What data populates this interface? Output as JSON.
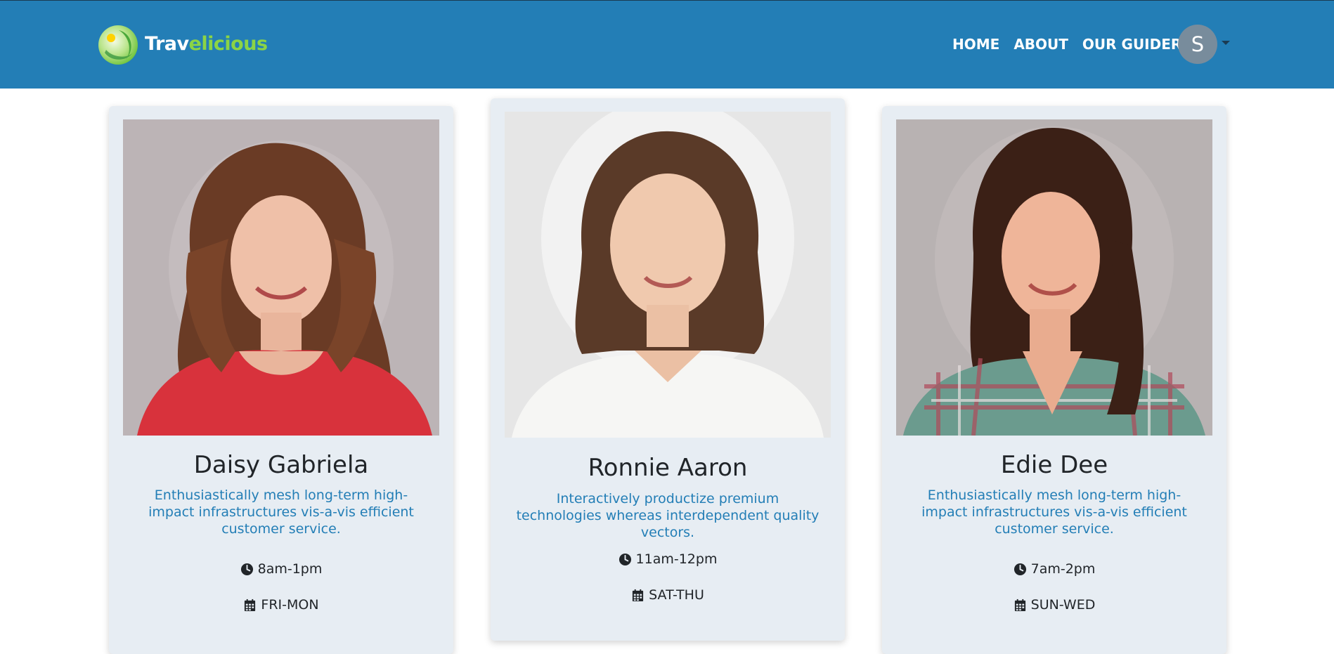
{
  "brand": {
    "name_part1": "Trav",
    "name_part2": "elicious"
  },
  "nav": {
    "items": [
      {
        "label": "HOME"
      },
      {
        "label": "ABOUT"
      },
      {
        "label": "OUR GUIDERS"
      }
    ],
    "avatar_initial": "S"
  },
  "guides": [
    {
      "name": "Daisy Gabriela",
      "description": "Enthusiastically mesh long-term high-impact infrastructures vis-a-vis efficient customer service.",
      "hours": "8am-1pm",
      "days": "FRI-MON"
    },
    {
      "name": "Ronnie Aaron",
      "description": "Interactively productize premium technologies whereas interdependent quality vectors.",
      "hours": "11am-12pm",
      "days": "SAT-THU"
    },
    {
      "name": "Edie Dee",
      "description": "Enthusiastically mesh long-term high-impact infrastructures vis-a-vis efficient customer service.",
      "hours": "7am-2pm",
      "days": "SUN-WED"
    }
  ],
  "icons": {
    "hours": "clock-icon",
    "days": "calendar-icon"
  },
  "colors": {
    "navbar": "#237eb6",
    "brand_accent": "#8bd445",
    "card_bg": "#e7edf3",
    "description_text": "#237eb6",
    "avatar_bg": "#788c9c"
  }
}
